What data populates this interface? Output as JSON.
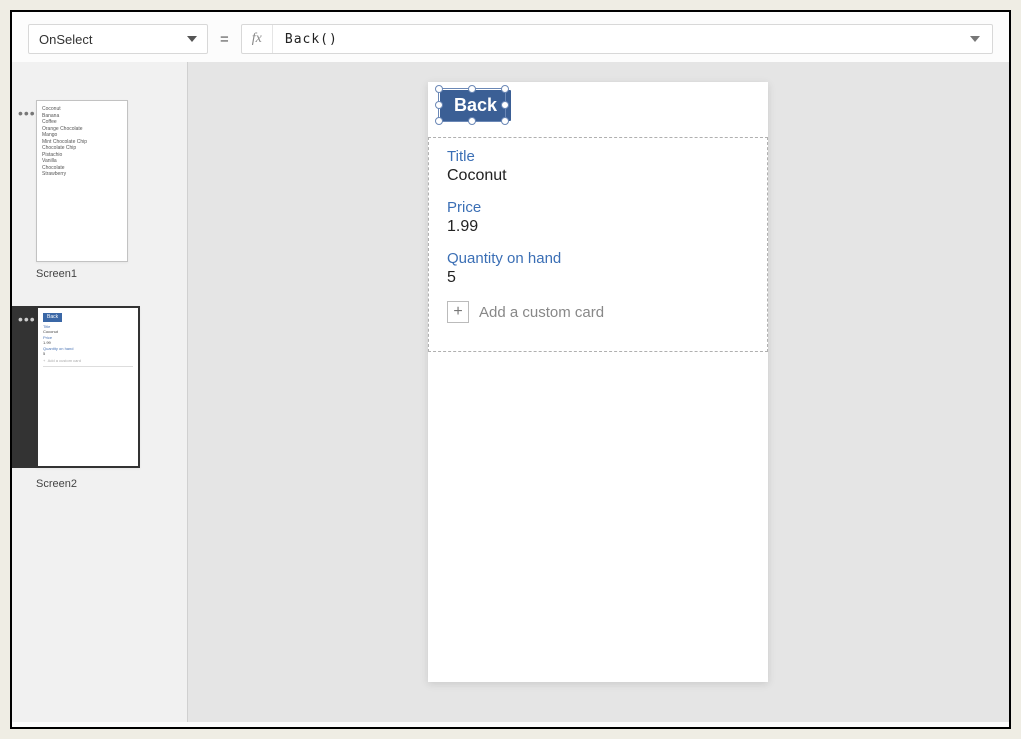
{
  "formula_bar": {
    "property": "OnSelect",
    "equals": "=",
    "fx_label": "fx",
    "expression": "Back()"
  },
  "sidebar": {
    "screen1": {
      "label": "Screen1",
      "items": [
        "Coconut",
        "Banana",
        "Coffee",
        "Orange Chocolate",
        "Mango",
        "Mint Chocolate Chip",
        "Chocolate Chip",
        "Pistachio",
        "Vanilla",
        "Chocolate",
        "Strawberry"
      ]
    },
    "screen2": {
      "label": "Screen2",
      "back": "Back",
      "title_label": "Title",
      "title_value": "Coconut",
      "price_label": "Price",
      "price_value": "1.99",
      "qty_label": "Quantity on hand",
      "qty_value": "5",
      "add_custom": "Add a custom card",
      "plus": "+"
    }
  },
  "canvas": {
    "back_button": "Back",
    "form": {
      "title_label": "Title",
      "title_value": "Coconut",
      "price_label": "Price",
      "price_value": "1.99",
      "qty_label": "Quantity on hand",
      "qty_value": "5",
      "add_custom": "Add a custom card",
      "plus": "+"
    }
  }
}
